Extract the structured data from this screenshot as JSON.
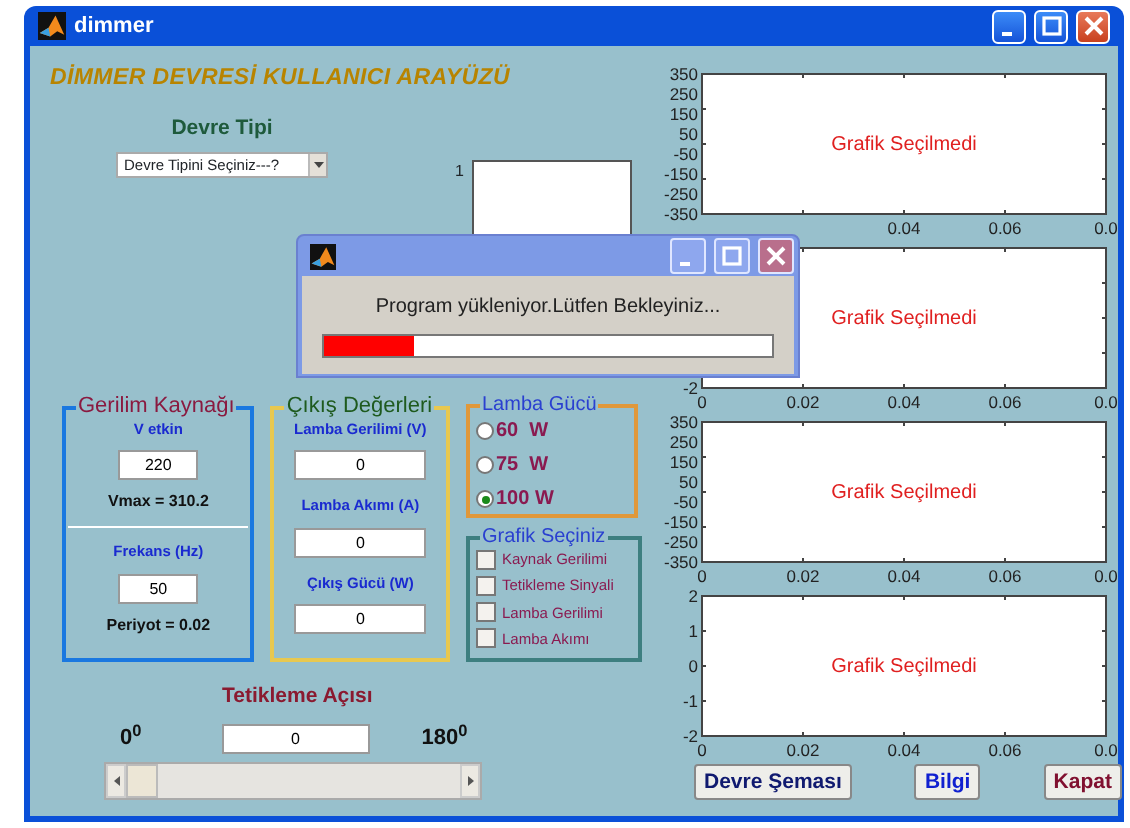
{
  "window": {
    "title": "dimmer"
  },
  "heading": "DİMMER DEVRESİ KULLANICI ARAYÜZÜ",
  "circuit_type": {
    "label": "Devre Tipi",
    "value": "Devre Tipini Seçiniz---?"
  },
  "small_axes": {
    "ytick": "1"
  },
  "voltage_source": {
    "title": "Gerilim Kaynağı",
    "fields": [
      {
        "label": "V etkin",
        "value": "220",
        "result": "Vmax = 310.2"
      },
      {
        "label": "Frekans (Hz)",
        "value": "50",
        "result": "Periyot = 0.02"
      }
    ]
  },
  "outputs": {
    "title": "Çıkış Değerleri",
    "fields": [
      {
        "label": "Lamba Gerilimi (V)",
        "value": "0"
      },
      {
        "label": "Lamba Akımı (A)",
        "value": "0"
      },
      {
        "label": "Çıkış Gücü (W)",
        "value": "0"
      }
    ]
  },
  "lamp_power": {
    "title": "Lamba Gücü",
    "options": [
      {
        "label": "60  W",
        "selected": false
      },
      {
        "label": "75  W",
        "selected": false
      },
      {
        "label": "100 W",
        "selected": true
      }
    ]
  },
  "graph_select": {
    "title": "Grafik Seçiniz",
    "options": [
      {
        "label": "Kaynak Gerilimi",
        "checked": false
      },
      {
        "label": "Tetikleme Sinyali",
        "checked": false
      },
      {
        "label": "Lamba Gerilimi",
        "checked": false
      },
      {
        "label": "Lamba Akımı",
        "checked": false
      }
    ]
  },
  "trigger_angle": {
    "label": "Tetikleme Açısı",
    "value": "0",
    "min_label": "0$^{0}$",
    "max_label": "180$^{0}$"
  },
  "plots": [
    {
      "message": "Grafik Seçilmedi",
      "y_tick_labels": [
        "350",
        "250",
        "150",
        "50",
        "-50",
        "-150",
        "-250",
        "-350"
      ],
      "x_tick_labels": [
        "0.04",
        "0.06",
        "0.0"
      ]
    },
    {
      "message": "Grafik Seçilmedi",
      "y_tick_labels": [
        "-2"
      ],
      "x_tick_labels": [
        "0",
        "0.02",
        "0.04",
        "0.06",
        "0.0"
      ]
    },
    {
      "message": "Grafik Seçilmedi",
      "y_tick_labels": [
        "350",
        "250",
        "150",
        "50",
        "-50",
        "-150",
        "-250",
        "-350"
      ],
      "x_tick_labels": [
        "0",
        "0.02",
        "0.04",
        "0.06",
        "0.0"
      ]
    },
    {
      "message": "Grafik Seçilmedi",
      "y_tick_labels": [
        "2",
        "1",
        "0",
        "-1",
        "-2"
      ],
      "x_tick_labels": [
        "0",
        "0.02",
        "0.04",
        "0.06",
        "0.0"
      ]
    }
  ],
  "buttons": [
    {
      "label": "Devre Şeması",
      "kind": "navy"
    },
    {
      "label": "Bilgi",
      "kind": "blue"
    },
    {
      "label": "Kapat",
      "kind": "maroon"
    }
  ],
  "dialog": {
    "message": "Program yükleniyor.Lütfen Bekleyiniz...",
    "level": 0.2
  }
}
